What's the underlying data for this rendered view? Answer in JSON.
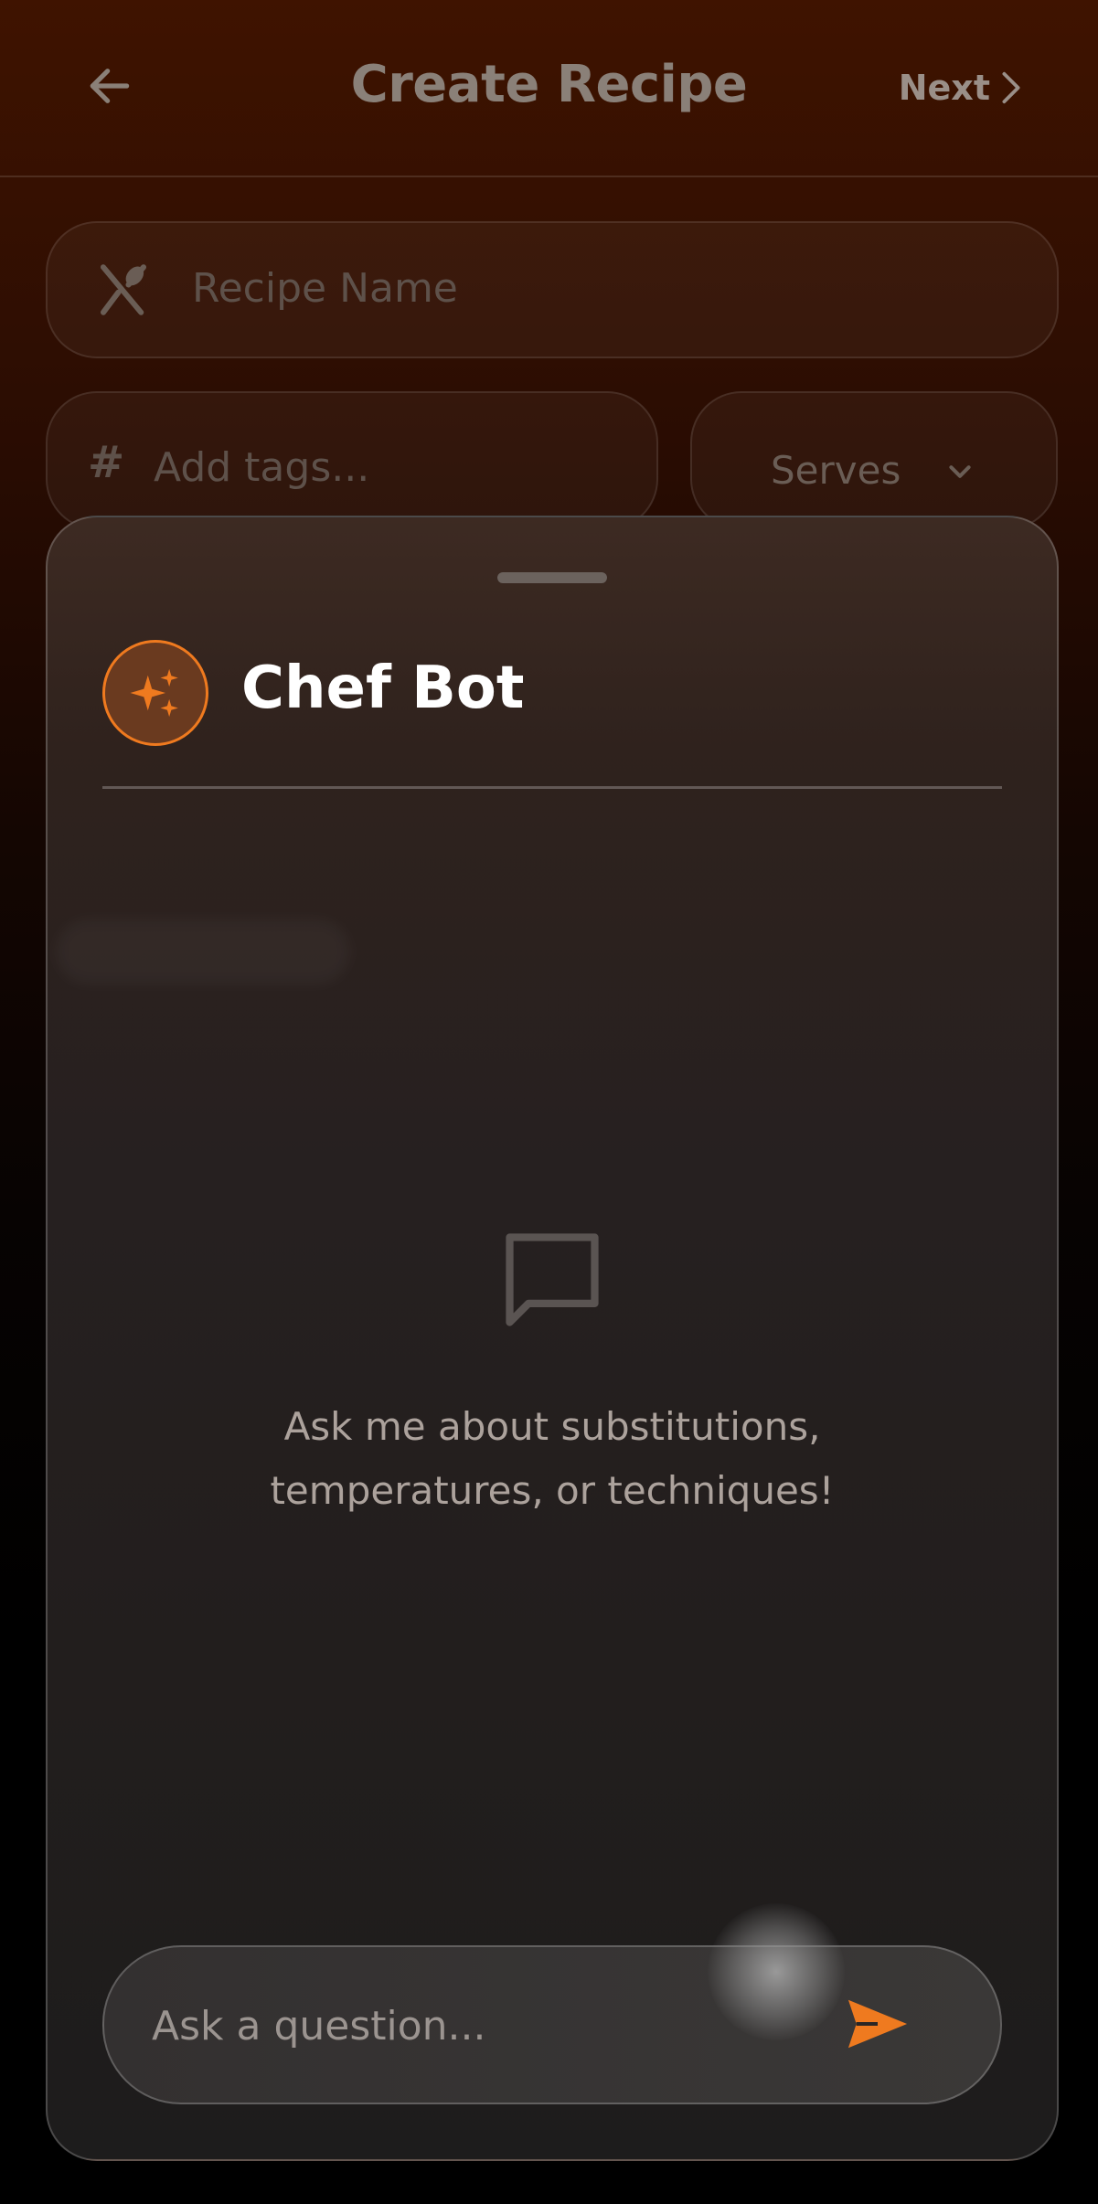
{
  "header": {
    "title": "Create Recipe",
    "next_label": "Next",
    "back_icon": "arrow-left-icon"
  },
  "form": {
    "recipe_name_placeholder": "Recipe Name",
    "tags_placeholder": "Add tags...",
    "serves_label": "Serves"
  },
  "chat": {
    "bot_name": "Chef Bot",
    "empty_message": "Ask me about substitutions, temperatures, or techniques!",
    "input_placeholder": "Ask a question...",
    "accent_color": "#ef7a1f",
    "icons": {
      "avatar": "sparkles-icon",
      "empty": "chat-bubble-icon",
      "send": "send-icon"
    }
  }
}
